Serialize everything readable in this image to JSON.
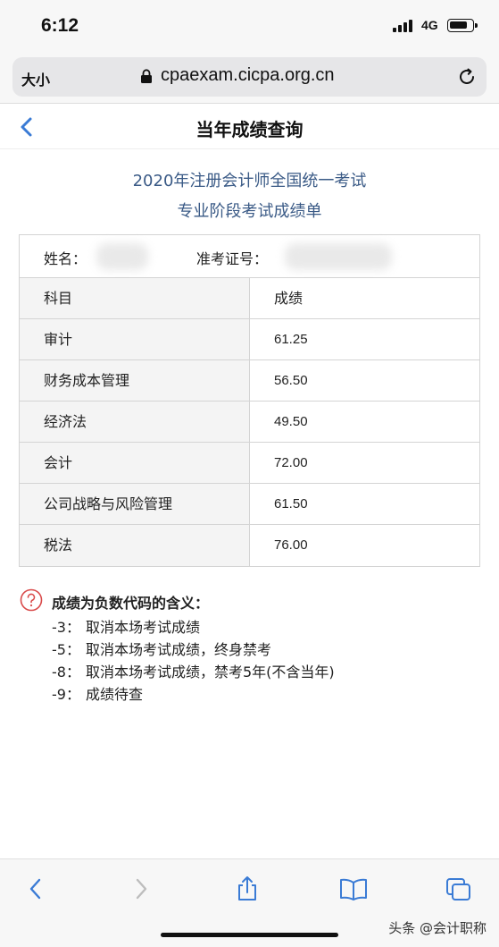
{
  "status_bar": {
    "time": "6:12",
    "network": "4G"
  },
  "browser": {
    "text_size_label": "大小",
    "url": "cpaexam.cicpa.org.cn"
  },
  "header": {
    "title": "当年成绩查询"
  },
  "report": {
    "title_line1": "2020年注册会计师全国统一考试",
    "title_line2": "专业阶段考试成绩单"
  },
  "candidate": {
    "name_label": "姓名：",
    "ticket_label": "准考证号："
  },
  "table": {
    "headers": [
      "科目",
      "成绩"
    ],
    "rows": [
      {
        "subject": "审计",
        "score": "61.25"
      },
      {
        "subject": "财务成本管理",
        "score": "56.50"
      },
      {
        "subject": "经济法",
        "score": "49.50"
      },
      {
        "subject": "会计",
        "score": "72.00"
      },
      {
        "subject": "公司战略与风险管理",
        "score": "61.50"
      },
      {
        "subject": "税法",
        "score": "76.00"
      }
    ]
  },
  "notes": {
    "title": "成绩为负数代码的含义：",
    "items": [
      {
        "code": "-3：",
        "text": "取消本场考试成绩"
      },
      {
        "code": "-5：",
        "text": "取消本场考试成绩，终身禁考"
      },
      {
        "code": "-8：",
        "text": "取消本场考试成绩，禁考5年(不含当年)"
      },
      {
        "code": "-9：",
        "text": "成绩待查"
      }
    ]
  },
  "toolbar": {
    "icons": [
      "back-icon",
      "forward-icon",
      "share-icon",
      "bookmarks-icon",
      "tabs-icon"
    ]
  },
  "watermark": "头条 @会计职称",
  "colors": {
    "accent": "#3a7bd5",
    "title_blue": "#3a5a86",
    "help_red": "#d94a4a"
  }
}
